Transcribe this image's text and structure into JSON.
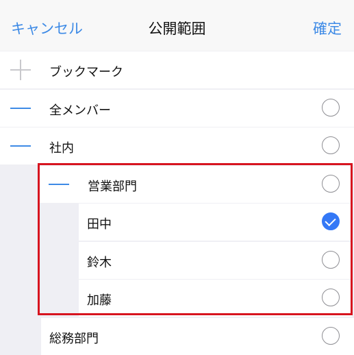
{
  "header": {
    "cancel_label": "キャンセル",
    "title": "公開範囲",
    "confirm_label": "確定"
  },
  "items": [
    {
      "label": "ブックマーク",
      "sign": "plus",
      "checked": null
    },
    {
      "label": "全メンバー",
      "sign": "minus",
      "checked": false
    },
    {
      "label": "社内",
      "sign": "minus",
      "checked": false
    },
    {
      "label": "営業部門",
      "sign": "minus",
      "checked": false
    },
    {
      "label": "田中",
      "sign": null,
      "checked": true
    },
    {
      "label": "鈴木",
      "sign": null,
      "checked": false
    },
    {
      "label": "加藤",
      "sign": null,
      "checked": false
    },
    {
      "label": "総務部門",
      "sign": null,
      "checked": false
    }
  ],
  "colors": {
    "accent": "#3d8ae6",
    "highlight_border": "#d7141f",
    "checked_fill": "#3478f6"
  }
}
